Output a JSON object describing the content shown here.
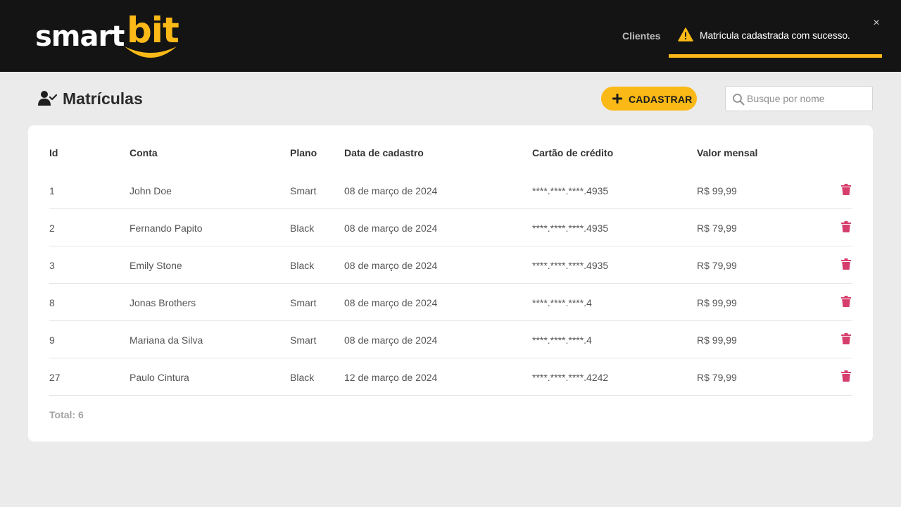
{
  "header": {
    "logo_smart": "smart",
    "logo_bit": "bit",
    "nav_clientes": "Clientes"
  },
  "toast": {
    "message": "Matrícula cadastrada com sucesso.",
    "close_symbol": "×",
    "icon": "warning-icon",
    "accent_color": "#fbb917",
    "progress_fraction": 0.97
  },
  "page": {
    "title": "Matrículas",
    "title_icon": "user-check-icon",
    "add_button_label": "CADASTRAR",
    "search_placeholder": "Busque por nome"
  },
  "table": {
    "headers": {
      "id": "Id",
      "conta": "Conta",
      "plano": "Plano",
      "data": "Data de cadastro",
      "cartao": "Cartão de crédito",
      "valor": "Valor mensal"
    },
    "rows": [
      {
        "id": "1",
        "conta": "John Doe",
        "plano": "Smart",
        "data": "08 de março de 2024",
        "cartao": "****.****.****.4935",
        "valor": "R$ 99,99"
      },
      {
        "id": "2",
        "conta": "Fernando Papito",
        "plano": "Black",
        "data": "08 de março de 2024",
        "cartao": "****.****.****.4935",
        "valor": "R$ 79,99"
      },
      {
        "id": "3",
        "conta": "Emily Stone",
        "plano": "Black",
        "data": "08 de março de 2024",
        "cartao": "****.****.****.4935",
        "valor": "R$ 79,99"
      },
      {
        "id": "8",
        "conta": "Jonas Brothers",
        "plano": "Smart",
        "data": "08 de março de 2024",
        "cartao": "****.****.****.4",
        "valor": "R$ 99,99"
      },
      {
        "id": "9",
        "conta": "Mariana da Silva",
        "plano": "Smart",
        "data": "08 de março de 2024",
        "cartao": "****.****.****.4",
        "valor": "R$ 99,99"
      },
      {
        "id": "27",
        "conta": "Paulo Cintura",
        "plano": "Black",
        "data": "12 de março de 2024",
        "cartao": "****.****.****.4242",
        "valor": "R$ 79,99"
      }
    ],
    "total": "Total: 6",
    "delete_icon": "trash-icon"
  },
  "colors": {
    "brand_yellow": "#fbb917",
    "header_bg": "#141414",
    "delete_pink": "#d63e6d",
    "page_bg": "#ebebeb"
  }
}
